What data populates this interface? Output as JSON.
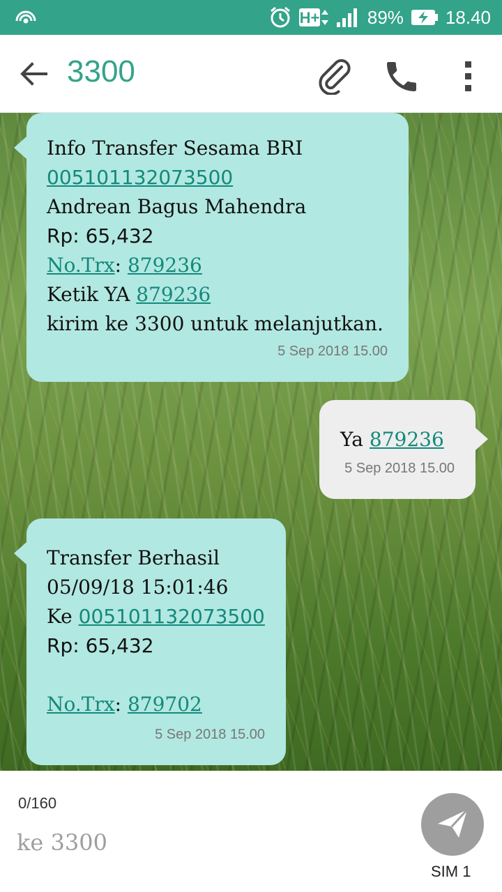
{
  "status_bar": {
    "battery": "89%",
    "time": "18.40",
    "network": "H+",
    "icons": [
      "signal-broadcast-icon",
      "alarm-icon",
      "network-h-plus-icon",
      "cell-signal-icon",
      "battery-charging-icon"
    ]
  },
  "app_bar": {
    "title": "3300",
    "icons": [
      "back-arrow-icon",
      "paperclip-icon",
      "phone-icon",
      "more-vert-icon"
    ]
  },
  "messages": [
    {
      "direction": "incoming",
      "lines": {
        "l1": "Info Transfer Sesama BRI",
        "l2_link": "005101132073500",
        "l3": "Andrean Bagus Mahendra",
        "l4": "Rp: 65,432",
        "l5_link": "No.Trx",
        "l5_sep": ": ",
        "l5_link2": "879236",
        "l6_pre": "Ketik YA ",
        "l6_link": "879236",
        "l7": "kirim ke 3300 untuk melanjutkan."
      },
      "timestamp": "5 Sep 2018 15.00"
    },
    {
      "direction": "outgoing",
      "lines": {
        "l1_pre": "Ya ",
        "l1_link": "879236"
      },
      "timestamp": "5 Sep 2018 15.00"
    },
    {
      "direction": "incoming",
      "lines": {
        "l1": "Transfer Berhasil",
        "l2": "05/09/18 15:01:46",
        "l3_pre": "Ke ",
        "l3_link": "005101132073500",
        "l4": "Rp: 65,432",
        "l6_link": "No.Trx",
        "l6_sep": ": ",
        "l6_link2": "879702"
      },
      "timestamp": "5 Sep 2018 15.00"
    }
  ],
  "composer": {
    "counter": "0/160",
    "placeholder": "ke 3300",
    "sim_label": "SIM 1",
    "send_icon": "send-icon"
  },
  "colors": {
    "status_bar": "#33a38a",
    "accent": "#33a38a",
    "incoming_bubble": "#b2e8e2",
    "outgoing_bubble": "#eeeeee",
    "link": "#13897a",
    "send_button": "#9e9e9e"
  }
}
